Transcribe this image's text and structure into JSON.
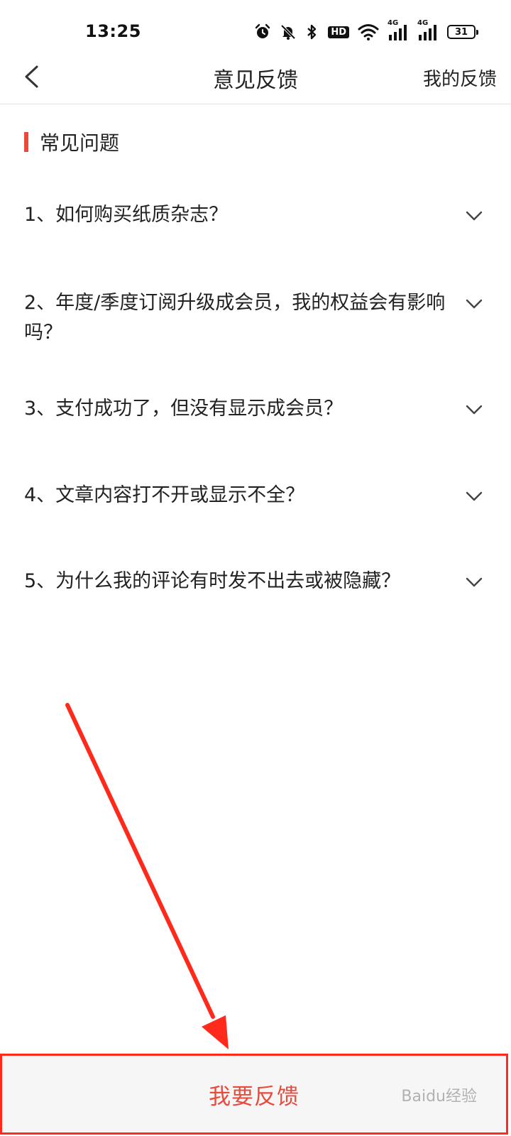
{
  "status_bar": {
    "time": "13:25",
    "hd_label": "HD",
    "signal_label_1": "4G",
    "signal_label_2": "4G",
    "battery_level": "31",
    "icons": [
      "alarm-icon",
      "mute-icon",
      "bluetooth-icon",
      "hd-icon",
      "wifi-icon",
      "signal-icon",
      "signal-icon",
      "battery-icon"
    ]
  },
  "nav": {
    "title": "意见反馈",
    "right_label": "我的反馈"
  },
  "section": {
    "title": "常见问题",
    "accent_color": "#e84a3c"
  },
  "faq": [
    {
      "text": "1、如何购买纸质杂志？"
    },
    {
      "text": "2、年度/季度订阅升级成会员，我的权益会有影响吗？"
    },
    {
      "text": "3、支付成功了，但没有显示成会员？"
    },
    {
      "text": "4、文章内容打不开或显示不全？"
    },
    {
      "text": "5、为什么我的评论有时发不出去或被隐藏？"
    }
  ],
  "footer": {
    "button_label": "我要反馈"
  },
  "watermark": "Baidu经验"
}
